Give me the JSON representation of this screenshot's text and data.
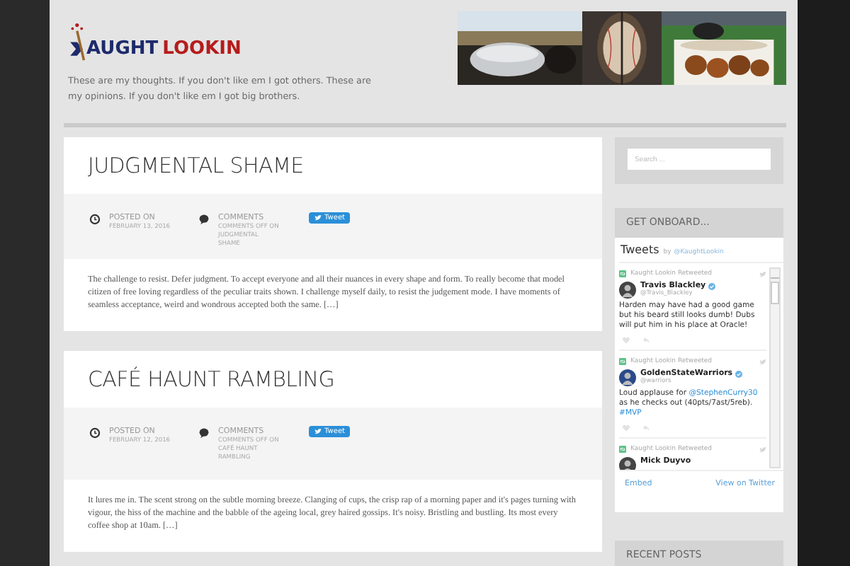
{
  "header": {
    "logo": {
      "part1": "AUGHT",
      "part2": "LOOKIN"
    },
    "tagline": "These are my thoughts. If you don't like em I got others. These are my opinions. If you don't like em I got big brothers."
  },
  "posts": [
    {
      "title": "JUDGMENTAL SHAME",
      "posted_label": "POSTED ON",
      "date": "FEBRUARY 13, 2016",
      "comments_label": "COMMENTS",
      "comments_text": "COMMENTS OFF ON JUDGMENTAL SHAME",
      "tweet_button": "Tweet",
      "excerpt": "The challenge to resist. Defer judgment. To accept everyone and all their nuances in every shape and form. To really become that model citizen of free loving regardless of the peculiar traits shown. I challenge myself daily, to resist the judgement mode. I have moments of seamless acceptance, weird and wondrous accepted both the same. […]"
    },
    {
      "title": "CAFÉ HAUNT RAMBLING",
      "posted_label": "POSTED ON",
      "date": "FEBRUARY 12, 2016",
      "comments_label": "COMMENTS",
      "comments_text": "COMMENTS OFF ON CAFÉ HAUNT RAMBLING",
      "tweet_button": "Tweet",
      "excerpt": "It lures me in. The scent strong on the subtle morning breeze. Clanging of cups, the crisp rap of a morning paper and it's pages turning with vigour, the hiss of the machine and the babble of the ageing local, grey haired gossips. It's noisy. Bristling and bustling. Its most every coffee shop at 10am. […]"
    }
  ],
  "sidebar": {
    "search": {
      "placeholder": "Search ..."
    },
    "onboard": {
      "heading": "GET ONBOARD...",
      "tweets_title": "Tweets",
      "tweets_by": "by",
      "tweets_handle": "@KaughtLookin",
      "tweets": [
        {
          "retweeted": "Kaught Lookin Retweeted",
          "name": "Travis Blackley",
          "handle": "@Travis_Blackley",
          "verified": true,
          "text": [
            {
              "text": "Harden may have had a good game but his beard still looks dumb! Dubs will put him in his place at Oracle!",
              "link": false
            }
          ]
        },
        {
          "retweeted": "Kaught Lookin Retweeted",
          "name": "GoldenStateWarriors",
          "handle": "@warriors",
          "verified": true,
          "text": [
            {
              "text": "Loud applause for ",
              "link": false
            },
            {
              "text": "@StephenCurry30",
              "link": true
            },
            {
              "text": " as he checks out (40pts/7ast/5reb). ",
              "link": false
            },
            {
              "text": "#MVP",
              "link": true
            }
          ]
        },
        {
          "retweeted": "Kaught Lookin Retweeted",
          "name": "Mick Duyvo",
          "verified": false
        }
      ],
      "embed": "Embed",
      "view": "View on Twitter"
    },
    "recent_heading": "RECENT POSTS"
  }
}
